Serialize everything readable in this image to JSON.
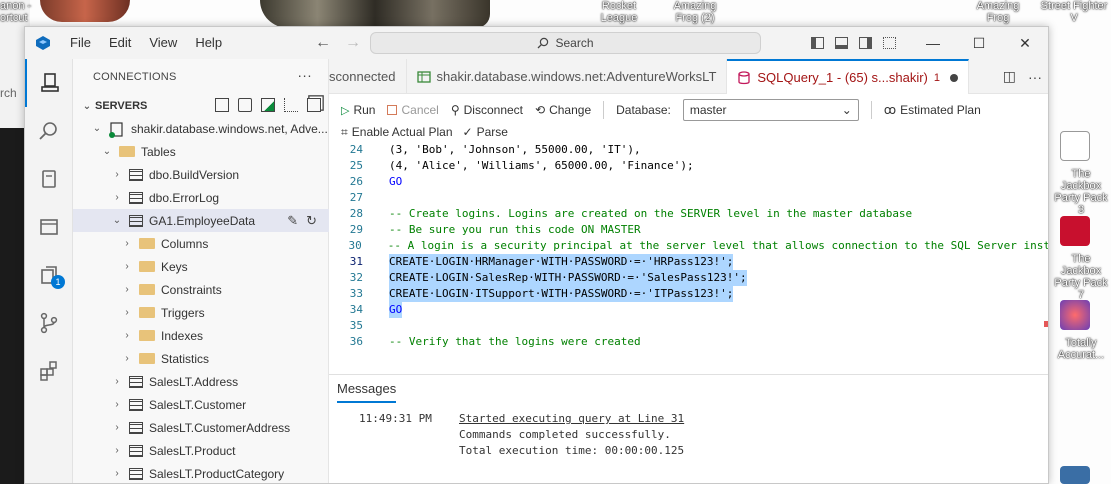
{
  "desktop": {
    "topleft_text": [
      "anon -",
      "ortcut"
    ],
    "left_edge_text": "rch",
    "top_icons": [
      {
        "label": "Rocket League"
      },
      {
        "label": "Amazing Frog (2)"
      },
      {
        "label": "Amazing Frog"
      },
      {
        "label": "Street Fighter V"
      }
    ],
    "right_icons": [
      {
        "label": "The Jackbox Party Pack 3"
      },
      {
        "label": "The Jackbox Party Pack 7"
      },
      {
        "label": "Totally Accurat..."
      }
    ]
  },
  "window": {
    "menu": [
      "File",
      "Edit",
      "View",
      "Help"
    ],
    "search_placeholder": "Search"
  },
  "activity": {
    "badge": "1"
  },
  "sidebar": {
    "title": "CONNECTIONS",
    "more": "···",
    "servers_label": "SERVERS",
    "tree": [
      {
        "label": "shakir.database.windows.net, Adve...",
        "type": "server",
        "indent": 1
      },
      {
        "label": "Tables",
        "type": "folder",
        "indent": 2
      },
      {
        "label": "dbo.BuildVersion",
        "type": "table",
        "indent": 3
      },
      {
        "label": "dbo.ErrorLog",
        "type": "table",
        "indent": 3
      },
      {
        "label": "GA1.EmployeeData",
        "type": "table",
        "indent": 3,
        "selected": true,
        "expanded": true
      },
      {
        "label": "Columns",
        "type": "folder",
        "indent": 4
      },
      {
        "label": "Keys",
        "type": "folder",
        "indent": 4
      },
      {
        "label": "Constraints",
        "type": "folder",
        "indent": 4
      },
      {
        "label": "Triggers",
        "type": "folder",
        "indent": 4
      },
      {
        "label": "Indexes",
        "type": "folder",
        "indent": 4
      },
      {
        "label": "Statistics",
        "type": "folder",
        "indent": 4
      },
      {
        "label": "SalesLT.Address",
        "type": "table",
        "indent": 3
      },
      {
        "label": "SalesLT.Customer",
        "type": "table",
        "indent": 3
      },
      {
        "label": "SalesLT.CustomerAddress",
        "type": "table",
        "indent": 3
      },
      {
        "label": "SalesLT.Product",
        "type": "table",
        "indent": 3
      },
      {
        "label": "SalesLT.ProductCategory",
        "type": "table",
        "indent": 3
      }
    ]
  },
  "tabs": [
    {
      "label": "sconnected"
    },
    {
      "label": "shakir.database.windows.net:AdventureWorksLT"
    },
    {
      "label": "SQLQuery_1 - (65) s...shakir)",
      "count": "1",
      "active": true
    }
  ],
  "toolbar": {
    "run": "Run",
    "cancel": "Cancel",
    "disconnect": "Disconnect",
    "change": "Change",
    "database_label": "Database:",
    "database_value": "master",
    "estimated_plan": "Estimated Plan",
    "enable_actual_plan": "Enable Actual Plan",
    "parse": "Parse"
  },
  "code": [
    {
      "n": "24",
      "text": "(3, 'Bob', 'Johnson', 55000.00, 'IT'),",
      "cls": "src"
    },
    {
      "n": "25",
      "text": "(4, 'Alice', 'Williams', 65000.00, 'Finance');",
      "cls": "src"
    },
    {
      "n": "26",
      "text": "GO",
      "cls": "kw"
    },
    {
      "n": "27",
      "text": "",
      "cls": "src"
    },
    {
      "n": "28",
      "text": "-- Create logins. Logins are created on the SERVER level in the master database",
      "cls": "comment"
    },
    {
      "n": "29",
      "text": "-- Be sure you run this code ON MASTER",
      "cls": "comment"
    },
    {
      "n": "30",
      "text": "-- A login is a security principal at the server level that allows connection to the SQL Server inst",
      "cls": "comment"
    },
    {
      "n": "31",
      "text": "CREATE·LOGIN·HRManager·WITH·PASSWORD·=·'HRPass123!';",
      "cls": "src",
      "sel": true
    },
    {
      "n": "32",
      "text": "CREATE·LOGIN·SalesRep·WITH·PASSWORD·=·'SalesPass123!';",
      "cls": "src",
      "sel": true
    },
    {
      "n": "33",
      "text": "CREATE·LOGIN·ITSupport·WITH·PASSWORD·=·'ITPass123!';",
      "cls": "src",
      "sel": true
    },
    {
      "n": "34",
      "text": "GO",
      "cls": "kw",
      "sel": true
    },
    {
      "n": "35",
      "text": "",
      "cls": "src"
    },
    {
      "n": "36",
      "text": "-- Verify that the logins were created",
      "cls": "comment"
    }
  ],
  "messages": {
    "tab": "Messages",
    "time": "11:49:31 PM",
    "lines": [
      "Started executing query at Line 31",
      "Commands completed successfully.",
      "Total execution time: 00:00:00.125"
    ]
  }
}
